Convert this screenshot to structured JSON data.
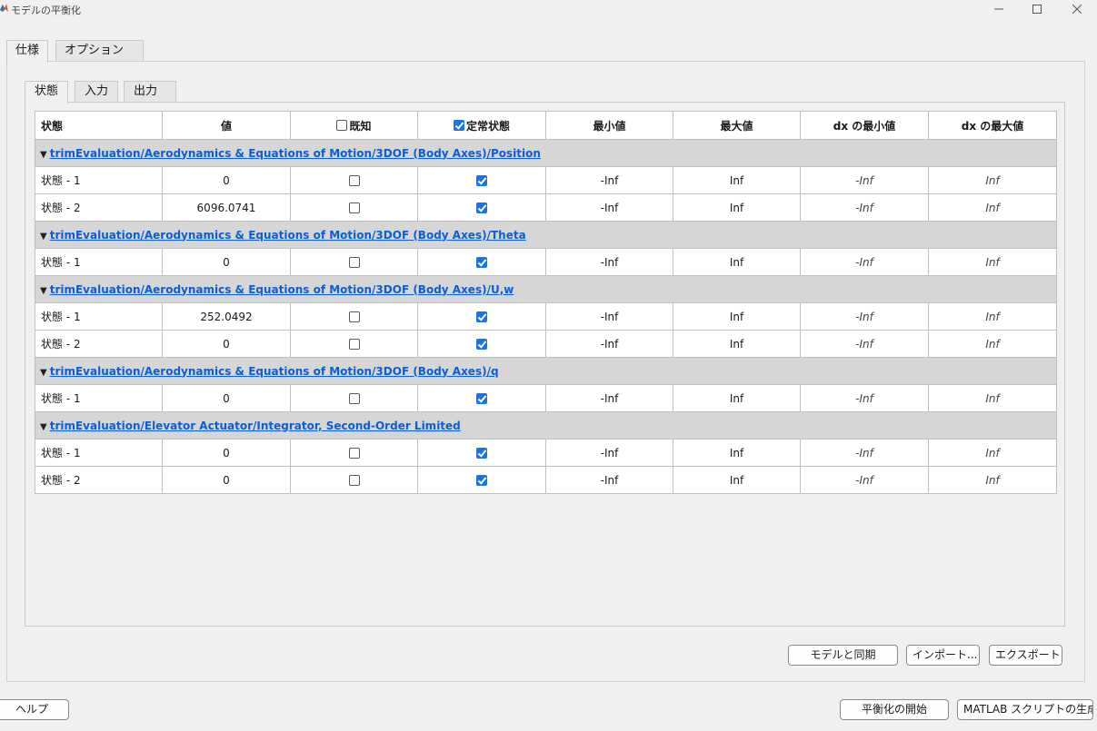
{
  "window": {
    "title": "モデルの平衡化",
    "controls": [
      "minimize-icon",
      "maximize-icon",
      "close-icon"
    ]
  },
  "outer_tabs": [
    "仕様",
    "オプション"
  ],
  "inner_tabs": [
    "状態",
    "入力",
    "出力"
  ],
  "table": {
    "headers": {
      "state": "状態",
      "value": "値",
      "known": "既知",
      "steady": "定常状態",
      "min": "最小値",
      "max": "最大値",
      "dxmin": "dx の最小値",
      "dxmax": "dx の最大値"
    },
    "groups": [
      {
        "title": "trimEvaluation/Aerodynamics & Equations of Motion/3DOF (Body Axes)/Position",
        "rows": [
          {
            "state": "状態 - 1",
            "value": "0",
            "known": false,
            "steady": true,
            "min": "-Inf",
            "max": "Inf",
            "dxmin": "-Inf",
            "dxmax": "Inf"
          },
          {
            "state": "状態 - 2",
            "value": "6096.0741",
            "known": false,
            "steady": true,
            "min": "-Inf",
            "max": "Inf",
            "dxmin": "-Inf",
            "dxmax": "Inf"
          }
        ]
      },
      {
        "title": "trimEvaluation/Aerodynamics & Equations of Motion/3DOF (Body Axes)/Theta",
        "rows": [
          {
            "state": "状態 - 1",
            "value": "0",
            "known": false,
            "steady": true,
            "min": "-Inf",
            "max": "Inf",
            "dxmin": "-Inf",
            "dxmax": "Inf"
          }
        ]
      },
      {
        "title": "trimEvaluation/Aerodynamics & Equations of Motion/3DOF (Body Axes)/U,w",
        "rows": [
          {
            "state": "状態 - 1",
            "value": "252.0492",
            "known": false,
            "steady": true,
            "min": "-Inf",
            "max": "Inf",
            "dxmin": "-Inf",
            "dxmax": "Inf"
          },
          {
            "state": "状態 - 2",
            "value": "0",
            "known": false,
            "steady": true,
            "min": "-Inf",
            "max": "Inf",
            "dxmin": "-Inf",
            "dxmax": "Inf"
          }
        ]
      },
      {
        "title": "trimEvaluation/Aerodynamics & Equations of Motion/3DOF (Body Axes)/q",
        "rows": [
          {
            "state": "状態 - 1",
            "value": "0",
            "known": false,
            "steady": true,
            "min": "-Inf",
            "max": "Inf",
            "dxmin": "-Inf",
            "dxmax": "Inf"
          }
        ]
      },
      {
        "title": "trimEvaluation/Elevator Actuator/Integrator, Second-Order Limited",
        "rows": [
          {
            "state": "状態 - 1",
            "value": "0",
            "known": false,
            "steady": true,
            "min": "-Inf",
            "max": "Inf",
            "dxmin": "-Inf",
            "dxmax": "Inf"
          },
          {
            "state": "状態 - 2",
            "value": "0",
            "known": false,
            "steady": true,
            "min": "-Inf",
            "max": "Inf",
            "dxmin": "-Inf",
            "dxmax": "Inf"
          }
        ]
      }
    ]
  },
  "buttons": {
    "sync": "モデルと同期",
    "import": "インポート...",
    "export": "エクスポート",
    "help": "ヘルプ",
    "start": "平衡化の開始",
    "script": "MATLAB スクリプトの生成"
  },
  "colors": {
    "link": "#0b5ed7",
    "checkbox_on": "#1a73e8",
    "group_bg": "#d6d6d6"
  }
}
